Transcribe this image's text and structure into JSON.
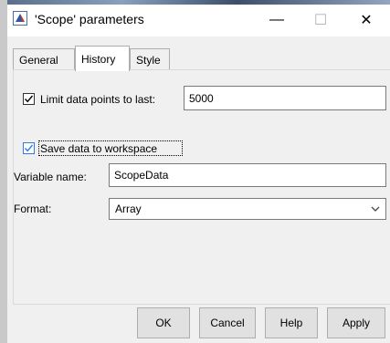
{
  "window": {
    "title": "'Scope' parameters",
    "minimize": "—",
    "maximize": "☐",
    "close": "✕"
  },
  "tabs": [
    {
      "label": "General",
      "active": false
    },
    {
      "label": "History",
      "active": true
    },
    {
      "label": "Style",
      "active": false
    }
  ],
  "history": {
    "limit_label": "Limit data points to last:",
    "limit_checked": true,
    "limit_value": "5000",
    "save_label": "Save data to workspace",
    "save_checked": true,
    "varname_label": "Variable name:",
    "varname_value": "ScopeData",
    "format_label": "Format:",
    "format_value": "Array"
  },
  "buttons": {
    "ok": "OK",
    "cancel": "Cancel",
    "help": "Help",
    "apply": "Apply"
  },
  "colors": {
    "accent": "#2d7be5",
    "dialog_bg": "#f0f0f0",
    "button_bg": "#e1e1e1"
  }
}
